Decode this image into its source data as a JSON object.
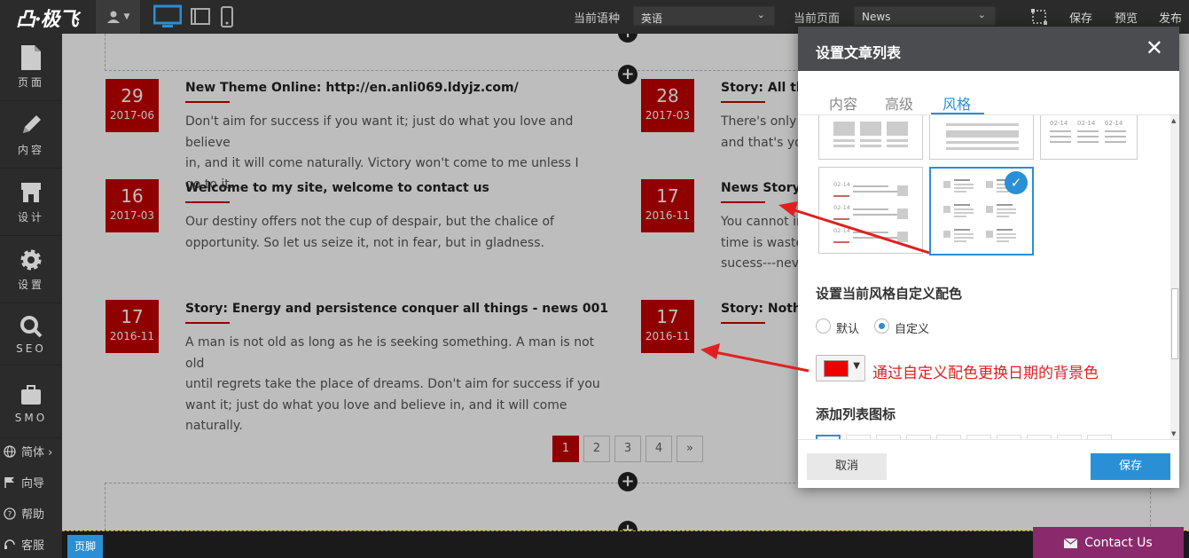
{
  "topbar": {
    "logo": "凸·极飞",
    "language_label": "当前语种",
    "language_value": "英语",
    "page_label": "当前页面",
    "page_value": "News",
    "save": "保存",
    "preview": "预览",
    "publish": "发布"
  },
  "sidebar": {
    "items": [
      {
        "label": "页面",
        "icon": "page-icon"
      },
      {
        "label": "内容",
        "icon": "pencil-icon"
      },
      {
        "label": "设计",
        "icon": "store-icon"
      },
      {
        "label": "设置",
        "icon": "gear-icon"
      },
      {
        "label": "SEO",
        "icon": "search-icon"
      },
      {
        "label": "SMO",
        "icon": "briefcase-icon"
      }
    ],
    "lang": "简体 ›",
    "guide": "向导",
    "help": "帮助",
    "service": "客服"
  },
  "news": [
    {
      "day": "29",
      "month": "2017-06",
      "title": "New Theme Online: http://en.anli069.ldyjz.com/",
      "body": [
        "Don't aim for success if you want it; just do what you love and believe",
        "in, and it will come naturally. Victory won't come to me unless I go to it."
      ]
    },
    {
      "day": "16",
      "month": "2017-03",
      "title": "Welcome to my site, welcome to contact us",
      "body": [
        "Our destiny offers not the cup of despair, but the chalice of",
        "opportunity. So let us seize it, not in fear, but in gladness."
      ]
    },
    {
      "day": "17",
      "month": "2016-11",
      "title": "Story: Energy and persistence conquer all things - news 001",
      "body": [
        "A man is not old as long as he is seeking something. A man is not old",
        "until regrets take the place of dreams. Don't aim for success if you",
        "want it; just do what you love and believe in, and it will come naturally."
      ]
    },
    {
      "day": "28",
      "month": "2017-03",
      "title": "Story: All thir",
      "body": [
        "There's only c",
        "and that's you"
      ]
    },
    {
      "day": "17",
      "month": "2016-11",
      "title": "News Story:",
      "body": [
        "You cannot im",
        "time is wasted",
        "sucess---neve"
      ]
    },
    {
      "day": "17",
      "month": "2016-11",
      "title": "Story: Nothin",
      "body": []
    }
  ],
  "pagination": [
    "1",
    "2",
    "3",
    "4",
    "»"
  ],
  "footer": {
    "label": "页脚",
    "contact": "Contact Us"
  },
  "dialog": {
    "title": "设置文章列表",
    "close": "✕",
    "tabs": [
      "内容",
      "高级",
      "风格"
    ],
    "active_tab": "风格",
    "thumb_dates": "02-14",
    "color_section": "设置当前风格自定义配色",
    "radio_default": "默认",
    "radio_custom": "自定义",
    "selected_radio": "自定义",
    "swatch_color": "#ee0000",
    "annotation": "通过自定义配色更换日期的背景色",
    "icon_section": "添加列表图标",
    "cancel": "取消",
    "save": "保存"
  },
  "colors": {
    "accent": "#2a8fd4",
    "date_bg": "#c40000",
    "annotation": "#e02020",
    "footer_contact": "#8a2a6d"
  }
}
